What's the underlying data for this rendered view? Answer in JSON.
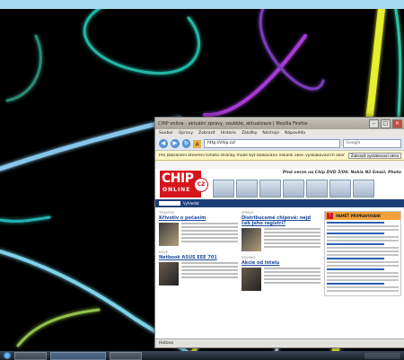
{
  "browser": {
    "title": "CHIP online - aktuální zprávy, soutěže, aktualizace | Mozilla Firefox",
    "menu": [
      "Soubor",
      "Úpravy",
      "Zobrazit",
      "Historie",
      "Záložky",
      "Nástroje",
      "Nápověda"
    ],
    "url": "http://chip.cz/",
    "search_placeholder": "Google",
    "popup_text": "Pro zabránění otevření tohoto stránky může být blokováno několik oken vyskakovacích oken",
    "popup_button": "Zobrazit vyskakovací okna",
    "status": "Hotovo"
  },
  "site": {
    "logo_text": "CHIP",
    "logo_sub": "ONLINE",
    "logo_badge": "CZ",
    "promo": "Plná verze na Chip DVD 5/09: Nokia N2 Email, Photo",
    "search_label": "Vyhledat",
    "articles_left": [
      {
        "section": "Tématem",
        "title": "Křivotiv o počasím"
      },
      {
        "section": "Nové",
        "title": "Netbook ASUS EEE 701"
      }
    ],
    "articles_mid": [
      {
        "section": "Zprávy",
        "title": "Distribucemé chipová: nejd čeb jeho registrí?"
      },
      {
        "section": "Novinky",
        "title": "Akcie od Intelu"
      }
    ],
    "sidebar_title": "PAMĚŤ PŘIPRAVOVANÍ"
  },
  "colors": {
    "top_frame": "#a7d9ee",
    "chip_red": "#d5151c",
    "navy": "#1d3f7a"
  }
}
